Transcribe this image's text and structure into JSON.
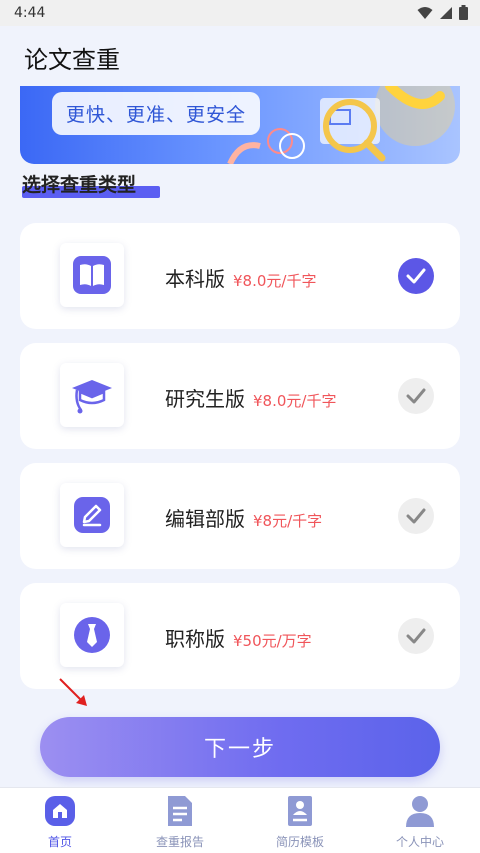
{
  "status_bar": {
    "time": "4:44"
  },
  "header": {
    "title": "论文查重"
  },
  "banner": {
    "tagline": "更快、更准、更安全"
  },
  "section": {
    "title": "选择查重类型"
  },
  "options": [
    {
      "name": "本科版",
      "price": "¥8.0元/千字",
      "selected": true,
      "icon": "book-icon"
    },
    {
      "name": "研究生版",
      "price": "¥8.0元/千字",
      "selected": false,
      "icon": "graduation-cap-icon"
    },
    {
      "name": "编辑部版",
      "price": "¥8元/千字",
      "selected": false,
      "icon": "edit-pen-icon"
    },
    {
      "name": "职称版",
      "price": "¥50元/万字",
      "selected": false,
      "icon": "tie-icon"
    }
  ],
  "actions": {
    "next_label": "下一步"
  },
  "bottom_nav": [
    {
      "label": "首页",
      "active": true,
      "icon": "home-icon"
    },
    {
      "label": "查重报告",
      "active": false,
      "icon": "report-icon"
    },
    {
      "label": "简历模板",
      "active": false,
      "icon": "resume-icon"
    },
    {
      "label": "个人中心",
      "active": false,
      "icon": "person-icon"
    }
  ],
  "colors": {
    "accent": "#5c57e6",
    "price": "#f0555a",
    "background": "#f0f3fc"
  }
}
